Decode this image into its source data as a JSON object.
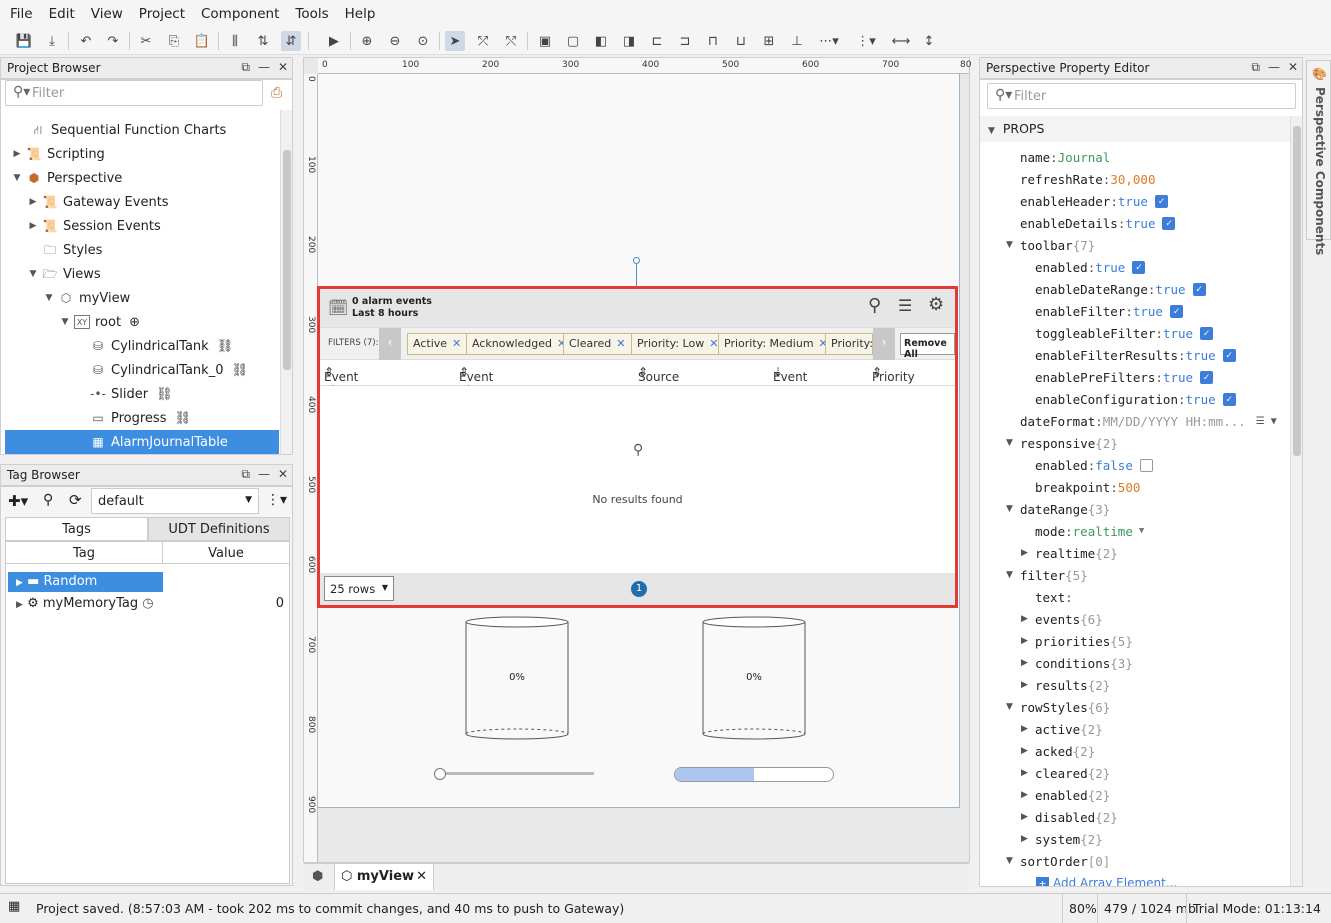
{
  "menu": [
    "File",
    "Edit",
    "View",
    "Project",
    "Component",
    "Tools",
    "Help"
  ],
  "project_browser": {
    "title": "Project Browser",
    "filter_placeholder": "Filter",
    "items": [
      {
        "label": "Sequential Function Charts",
        "icon": "sfc-icon"
      },
      {
        "label": "Scripting",
        "icon": "script-icon"
      },
      {
        "label": "Perspective",
        "icon": "perspective-icon"
      },
      {
        "label": "Gateway Events",
        "icon": "script-icon"
      },
      {
        "label": "Session Events",
        "icon": "script-icon"
      },
      {
        "label": "Styles",
        "icon": "style-icon"
      },
      {
        "label": "Views",
        "icon": "folder-icon"
      },
      {
        "label": "myView",
        "icon": "view-icon"
      },
      {
        "label": "root",
        "icon": "coord-container-icon"
      },
      {
        "label": "CylindricalTank",
        "icon": "tank-icon"
      },
      {
        "label": "CylindricalTank_0",
        "icon": "tank-icon"
      },
      {
        "label": "Slider",
        "icon": "slider-icon"
      },
      {
        "label": "Progress",
        "icon": "progress-icon"
      },
      {
        "label": "AlarmJournalTable",
        "icon": "table-icon"
      }
    ]
  },
  "tag_browser": {
    "title": "Tag Browser",
    "provider": "default",
    "tabs": [
      "Tags",
      "UDT Definitions"
    ],
    "columns": [
      "Tag",
      "Value"
    ],
    "rows": [
      {
        "tag": "Random",
        "value": ""
      },
      {
        "tag": "myMemoryTag",
        "value": "0"
      }
    ]
  },
  "designer": {
    "ruler_h": [
      "0",
      "100",
      "200",
      "300",
      "400",
      "500",
      "600",
      "700",
      "80"
    ],
    "ruler_v": [
      "0",
      "100",
      "200",
      "300",
      "400",
      "500",
      "600",
      "700",
      "800",
      "900"
    ],
    "alarm_table": {
      "events_count": "0 alarm events",
      "range": "Last 8 hours",
      "filters_label": "FILTERS (7):",
      "chips": [
        "Active",
        "Acknowledged",
        "Cleared",
        "Priority: Low",
        "Priority: Medium",
        "Priority: H"
      ],
      "remove_all": "Remove All",
      "columns": [
        "Event Time",
        "Event Id",
        "Source",
        "Event State",
        "Priority"
      ],
      "empty": "No results found",
      "rows_select": "25 rows",
      "page": "1"
    },
    "tank1_label": "0%",
    "tank2_label": "0%",
    "slider_value": 0,
    "progress_value": 0.5,
    "tab_label": "myView"
  },
  "property_editor": {
    "title": "Perspective Property Editor",
    "filter_placeholder": "Filter",
    "section": "PROPS",
    "side_tab": "Perspective Components",
    "rows": [
      {
        "k": "name",
        "v": "Journal",
        "t": "g"
      },
      {
        "k": "refreshRate",
        "v": "30,000",
        "t": "o"
      },
      {
        "k": "enableHeader",
        "v": "true",
        "t": "b",
        "chk": true
      },
      {
        "k": "enableDetails",
        "v": "true",
        "t": "b",
        "chk": true
      },
      {
        "k": "toolbar",
        "v": "{7}",
        "t": "c",
        "exp": "open"
      },
      {
        "k": "enabled",
        "v": "true",
        "t": "b",
        "chk": true
      },
      {
        "k": "enableDateRange",
        "v": "true",
        "t": "b",
        "chk": true
      },
      {
        "k": "enableFilter",
        "v": "true",
        "t": "b",
        "chk": true
      },
      {
        "k": "toggleableFilter",
        "v": "true",
        "t": "b",
        "chk": true
      },
      {
        "k": "enableFilterResults",
        "v": "true",
        "t": "b",
        "chk": true
      },
      {
        "k": "enablePreFilters",
        "v": "true",
        "t": "b",
        "chk": true
      },
      {
        "k": "enableConfiguration",
        "v": "true",
        "t": "b",
        "chk": true
      },
      {
        "k": "dateFormat",
        "v": "MM/DD/YYYY HH:mm...",
        "t": "c"
      },
      {
        "k": "responsive",
        "v": "{2}",
        "t": "c",
        "exp": "open"
      },
      {
        "k": "enabled",
        "v": "false",
        "t": "b",
        "chk": false
      },
      {
        "k": "breakpoint",
        "v": "500",
        "t": "o"
      },
      {
        "k": "dateRange",
        "v": "{3}",
        "t": "c",
        "exp": "open"
      },
      {
        "k": "mode",
        "v": "realtime",
        "t": "g"
      },
      {
        "k": "realtime",
        "v": "{2}",
        "t": "c",
        "exp": "closed"
      },
      {
        "k": "filter",
        "v": "{5}",
        "t": "c",
        "exp": "open"
      },
      {
        "k": "text",
        "v": "",
        "t": "g"
      },
      {
        "k": "events",
        "v": "{6}",
        "t": "c",
        "exp": "closed"
      },
      {
        "k": "priorities",
        "v": "{5}",
        "t": "c",
        "exp": "closed"
      },
      {
        "k": "conditions",
        "v": "{3}",
        "t": "c",
        "exp": "closed"
      },
      {
        "k": "results",
        "v": "{2}",
        "t": "c",
        "exp": "closed"
      },
      {
        "k": "rowStyles",
        "v": "{6}",
        "t": "c",
        "exp": "open"
      },
      {
        "k": "active",
        "v": "{2}",
        "t": "c",
        "exp": "closed"
      },
      {
        "k": "acked",
        "v": "{2}",
        "t": "c",
        "exp": "closed"
      },
      {
        "k": "cleared",
        "v": "{2}",
        "t": "c",
        "exp": "closed"
      },
      {
        "k": "enabled",
        "v": "{2}",
        "t": "c",
        "exp": "closed"
      },
      {
        "k": "disabled",
        "v": "{2}",
        "t": "c",
        "exp": "closed"
      },
      {
        "k": "system",
        "v": "{2}",
        "t": "c",
        "exp": "closed"
      },
      {
        "k": "sortOrder",
        "v": "[0]",
        "t": "c",
        "exp": "open"
      }
    ],
    "add_array": "Add Array Element..."
  },
  "status": {
    "message": "Project saved. (8:57:03 AM - took 202 ms to commit changes, and 40 ms to push to Gateway)",
    "zoom": "80%",
    "memory": "479 / 1024 mb",
    "trial": "Trial Mode: 01:13:14"
  }
}
